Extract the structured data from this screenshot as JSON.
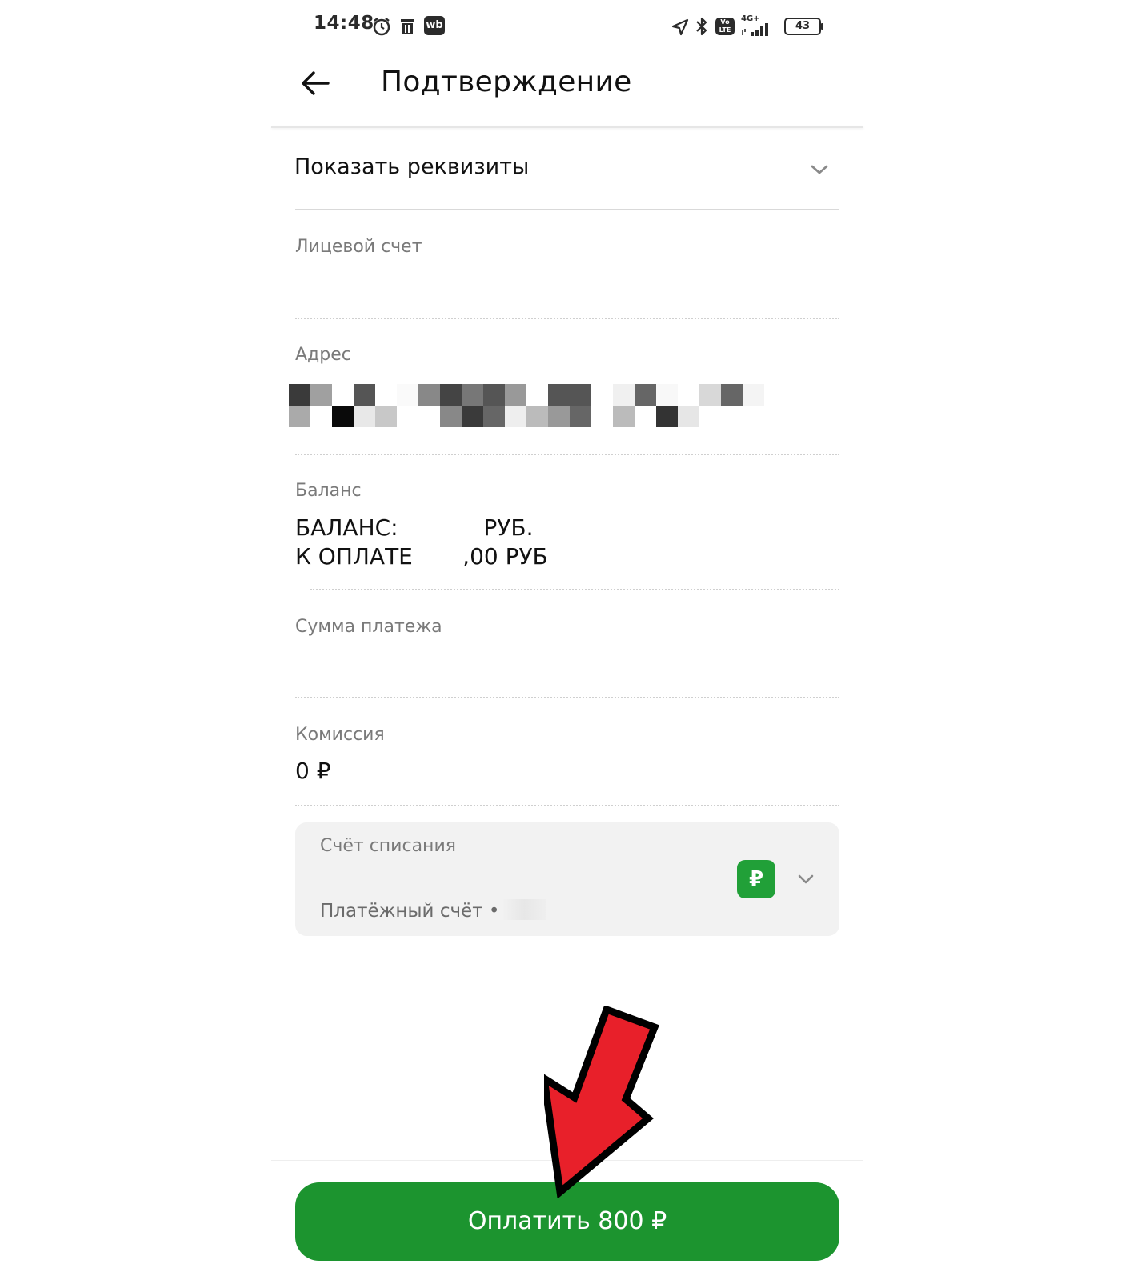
{
  "status_bar": {
    "time": "14:48",
    "icons": [
      "alarm-icon",
      "trash-icon",
      "wb-app-icon",
      "location-arrow-icon",
      "bluetooth-icon",
      "volte-icon",
      "signal-4g-icon"
    ],
    "wb_label": "wb",
    "volte_label": "Vo LTE",
    "network_label": "4G+",
    "battery": "43"
  },
  "header": {
    "title": "Подтверждение",
    "back_icon": "arrow-left-icon"
  },
  "details_toggle": {
    "label": "Показать реквизиты",
    "icon": "chevron-down-icon"
  },
  "fields": {
    "account": {
      "label": "Лицевой счет",
      "value": ""
    },
    "address": {
      "label": "Адрес"
    },
    "balance": {
      "label": "Баланс",
      "line1": "БАЛАНС:            РУБ.",
      "line2": "К ОПЛАТЕ       ,00 РУБ"
    },
    "payment_sum": {
      "label": "Сумма платежа",
      "value": ""
    },
    "commission": {
      "label": "Комиссия",
      "value": "0 ₽"
    }
  },
  "debit_account": {
    "label": "Счёт списания",
    "account_name": "Платёжный счёт ••",
    "currency_badge": "₽",
    "icon": "chevron-down-icon"
  },
  "pay_button": {
    "label": "Оплатить 800  ₽"
  },
  "colors": {
    "accent_green": "#1c942f",
    "badge_green": "#21a038",
    "annotation_red": "#e8202a"
  }
}
